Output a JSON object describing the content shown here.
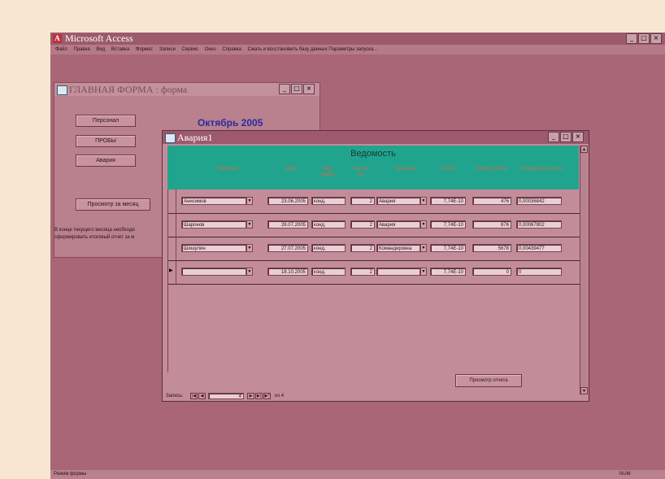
{
  "app": {
    "title": "Microsoft Access",
    "menu": [
      "Файл",
      "Правка",
      "Вид",
      "Вставка",
      "Формат",
      "Записи",
      "Сервис",
      "Окно",
      "Справка"
    ],
    "menu_extra": "Сжать и восстановить базу данных  Параметры запуска...",
    "window_buttons": [
      "_",
      "□",
      "×"
    ],
    "status_left": "Режим формы",
    "status_right": "NUM"
  },
  "main_form": {
    "title": "ГЛАВНАЯ ФОРМА : форма",
    "month_label": "Октябрь 2005",
    "buttons": [
      "Персонал",
      "ПРОБЫ",
      "Авария",
      "Просмотр за месяц"
    ],
    "note_line1": "В конце текущего месяца необходи",
    "note_line2": "сформировать итоговый отчет за м"
  },
  "avaria_form": {
    "title": "Авария1",
    "heading": "Ведомость",
    "columns": [
      "Фамилия",
      "Дата",
      "Вид пробы",
      "Кол-во, шт.",
      "Причина",
      "Коэф.",
      "Расход, куб.м",
      "Потеря газа, куб.м"
    ],
    "rows": [
      {
        "name": "Анисимов",
        "date": "23.06.2005",
        "kind": "конд.",
        "qty": "2",
        "reason": "Авария",
        "coef": "7,74E-10",
        "volume": "476",
        "loss": "0,00036842"
      },
      {
        "name": "Шаронов",
        "date": "26.07.2005",
        "kind": "конд.",
        "qty": "2",
        "reason": "Авария",
        "coef": "7,74E-10",
        "volume": "876",
        "loss": "0,00067802"
      },
      {
        "name": "Шишулин",
        "date": "27.07.2005",
        "kind": "конд.",
        "qty": "2",
        "reason": "Командировка",
        "coef": "7,74E-10",
        "volume": "5678",
        "loss": "0,00439477"
      },
      {
        "name": "",
        "date": "18.10.2005",
        "kind": "конд.",
        "qty": "2",
        "reason": "",
        "coef": "7,74E-10",
        "volume": "0",
        "loss": "0"
      }
    ],
    "preview_button": "Просмотр отчета",
    "nav_label": "Запись:",
    "nav_of": "из 4",
    "nav_current": "4"
  }
}
